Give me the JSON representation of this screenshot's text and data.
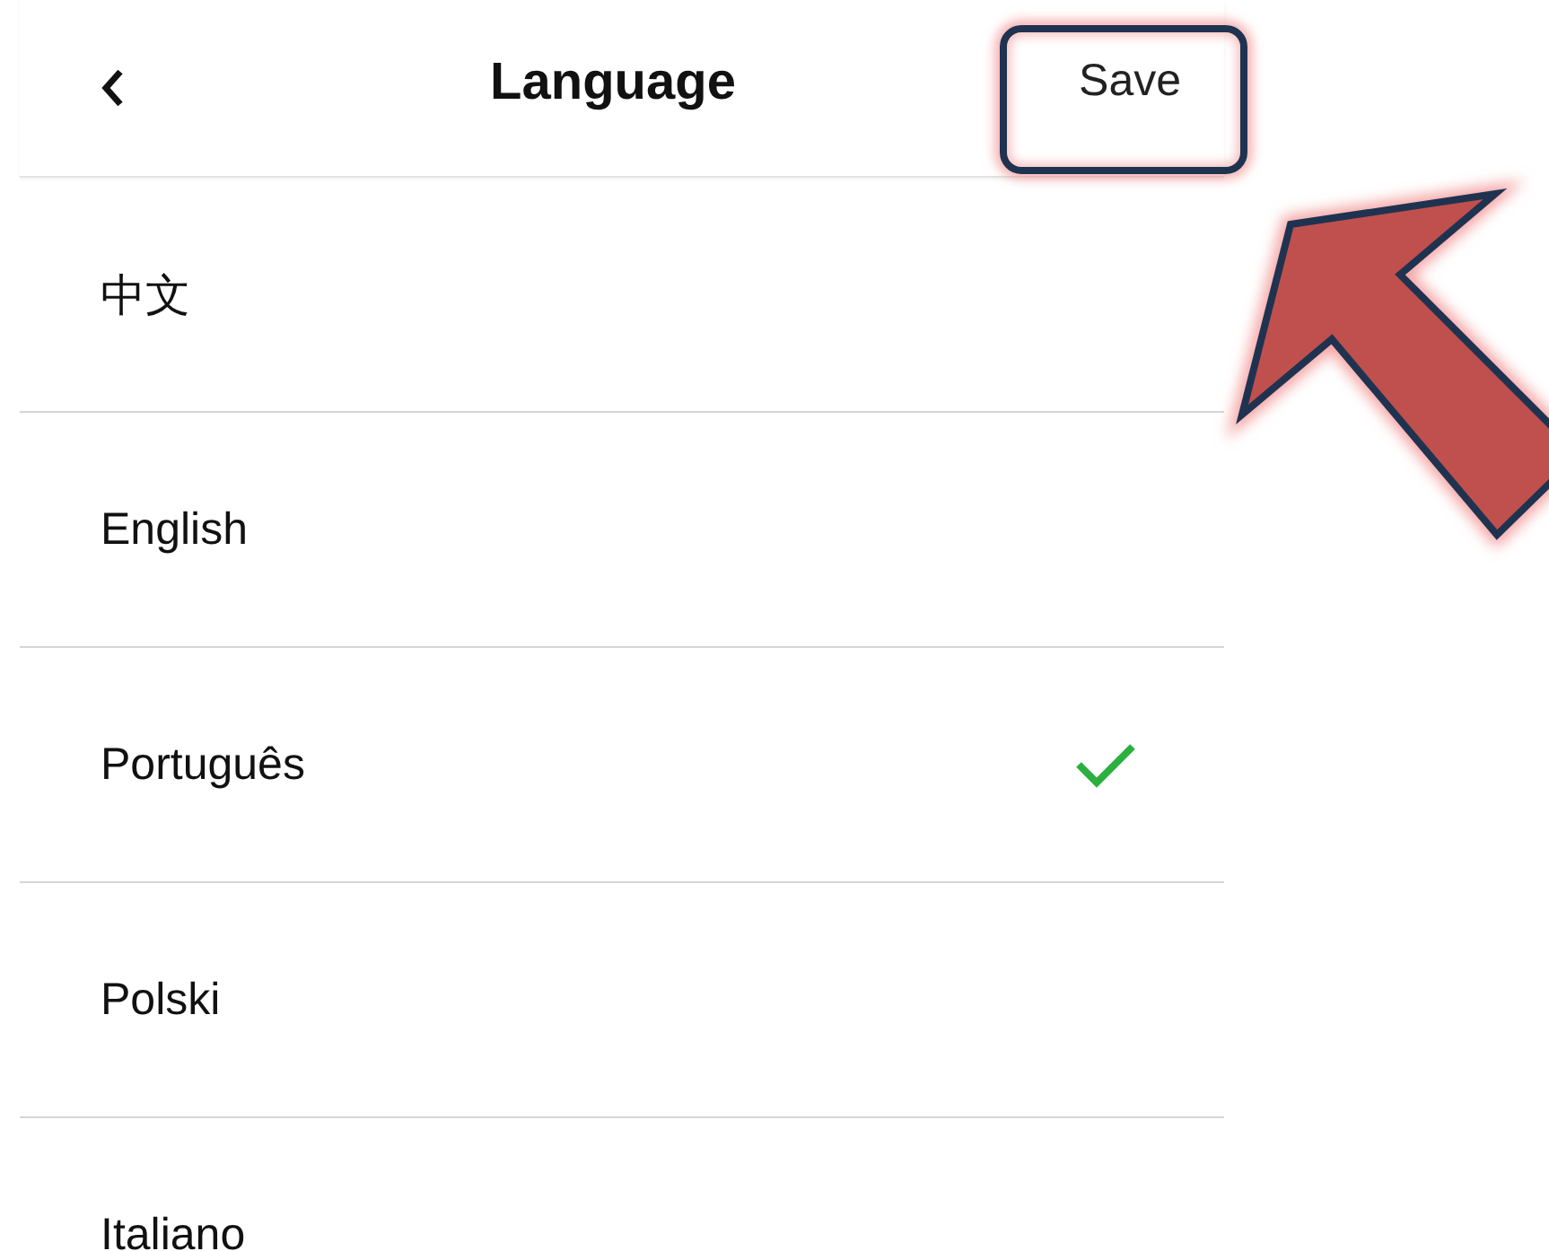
{
  "header": {
    "title": "Language",
    "action": "Save"
  },
  "languages": [
    {
      "label": "中文",
      "selected": false
    },
    {
      "label": "English",
      "selected": false
    },
    {
      "label": "Português",
      "selected": true
    },
    {
      "label": "Polski",
      "selected": false
    },
    {
      "label": "Italiano",
      "selected": false
    }
  ]
}
